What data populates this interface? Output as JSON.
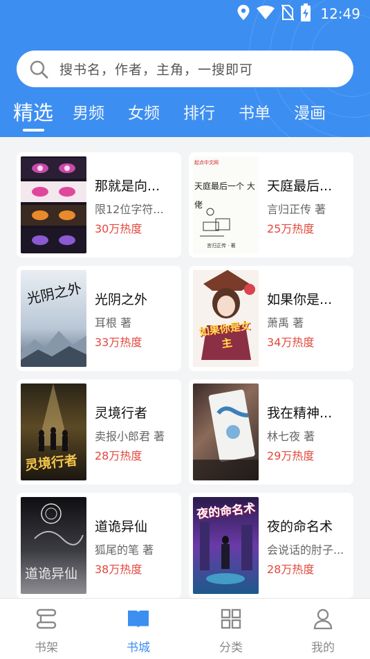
{
  "status_bar": {
    "time": "12:49",
    "icons": [
      "location-icon",
      "wifi-icon",
      "no-sim-icon",
      "battery-charging-icon"
    ]
  },
  "search": {
    "placeholder": "搜书名，作者，主角，一搜即可",
    "icon": "search-icon"
  },
  "tabs": [
    {
      "label": "精选",
      "active": true
    },
    {
      "label": "男频",
      "active": false
    },
    {
      "label": "女频",
      "active": false
    },
    {
      "label": "排行",
      "active": false
    },
    {
      "label": "书单",
      "active": false
    },
    {
      "label": "漫画",
      "active": false
    }
  ],
  "books": [
    {
      "title": "那就是向...",
      "author": "限12位字符...",
      "heat": "30万热度",
      "cover_text": ""
    },
    {
      "title": "天庭最后...",
      "author": "言归正传 著",
      "heat": "25万热度",
      "cover_text": "天庭最后一个 大佬",
      "cover_sub": "言归正传 · 著",
      "cover_logo": "起点中文网"
    },
    {
      "title": "光阴之外",
      "author": "耳根  著",
      "heat": "33万热度",
      "cover_text": "光阴之外"
    },
    {
      "title": "如果你是...",
      "author": "萧禹 著",
      "heat": "34万热度",
      "cover_text": "如果你是女主"
    },
    {
      "title": "灵境行者",
      "author": "卖报小郎君 著",
      "heat": "28万热度",
      "cover_text": "灵境行者"
    },
    {
      "title": "我在精神...",
      "author": "林七夜 著",
      "heat": "29万热度",
      "cover_text": ""
    },
    {
      "title": "道诡异仙",
      "author": "狐尾的笔 著",
      "heat": "38万热度",
      "cover_text": "道诡异仙"
    },
    {
      "title": "夜的命名术",
      "author": "会说话的肘子...",
      "heat": "28万热度",
      "cover_text": "夜的命名术"
    }
  ],
  "bottom_nav": [
    {
      "label": "书架",
      "icon": "bookshelf-icon",
      "active": false
    },
    {
      "label": "书城",
      "icon": "open-book-icon",
      "active": true
    },
    {
      "label": "分类",
      "icon": "grid-icon",
      "active": false
    },
    {
      "label": "我的",
      "icon": "person-icon",
      "active": false
    }
  ],
  "colors": {
    "primary": "#3d8ef1",
    "heat_text": "#e2483d",
    "background": "#f3f4f6"
  }
}
